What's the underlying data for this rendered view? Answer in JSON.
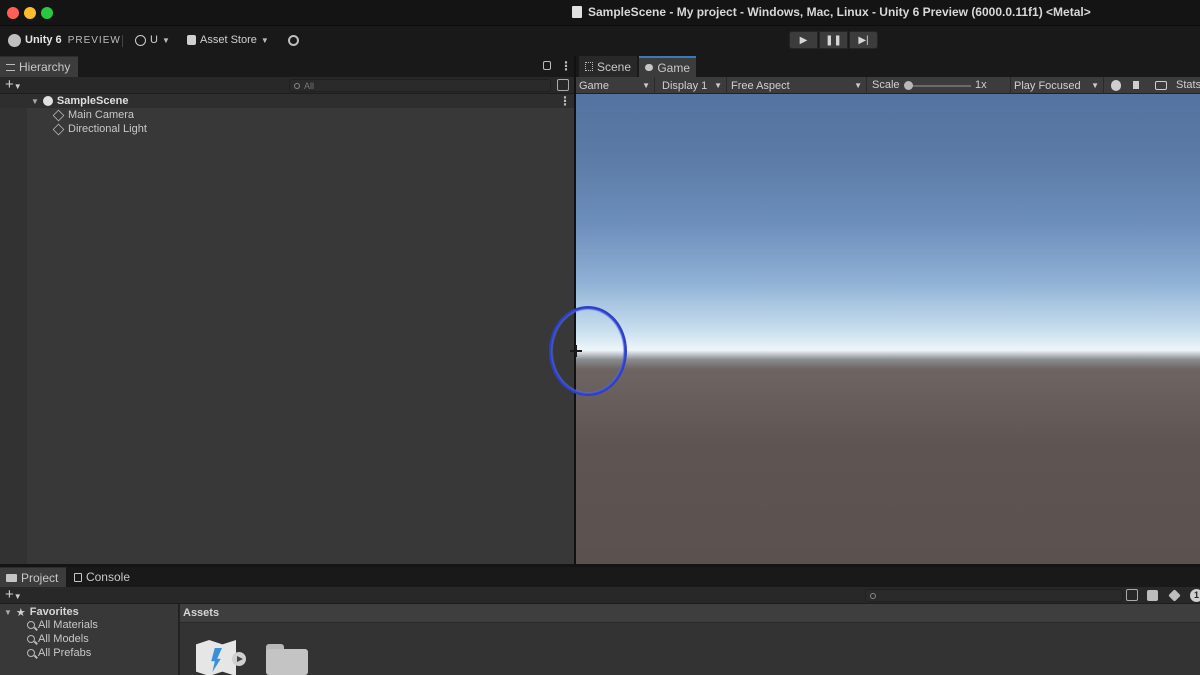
{
  "window": {
    "title": "SampleScene - My project - Windows, Mac, Linux - Unity 6 Preview (6000.0.11f1) <Metal>"
  },
  "toolbar": {
    "brand": "Unity 6",
    "brand_tag": "PREVIEW",
    "account_label": "U",
    "asset_store_label": "Asset Store",
    "play_label": "▶",
    "pause_label": "❚❚",
    "step_label": "▶|"
  },
  "hierarchy": {
    "tab_label": "Hierarchy",
    "search_placeholder": "All",
    "scene_name": "SampleScene",
    "items": [
      {
        "label": "Main Camera"
      },
      {
        "label": "Directional Light"
      }
    ]
  },
  "game_panel": {
    "tabs": [
      {
        "label": "Scene"
      },
      {
        "label": "Game"
      }
    ],
    "mode_dropdown": "Game",
    "display_dropdown": "Display 1",
    "aspect_dropdown": "Free Aspect",
    "scale_label": "Scale",
    "scale_value": "1x",
    "play_mode_dropdown": "Play Focused",
    "stats_label": "Stats"
  },
  "project_panel": {
    "tabs": [
      {
        "label": "Project"
      },
      {
        "label": "Console"
      }
    ],
    "favorites_label": "Favorites",
    "favorites": [
      {
        "label": "All Materials"
      },
      {
        "label": "All Models"
      },
      {
        "label": "All Prefabs"
      }
    ],
    "assets_title": "Assets",
    "count_badge": "1"
  },
  "colors": {
    "accent_tab": "#3a79bb",
    "cursor_ring": "#2d3fc7",
    "close": "#ff5f57",
    "minimize": "#febc2e",
    "maximize": "#28c840"
  }
}
